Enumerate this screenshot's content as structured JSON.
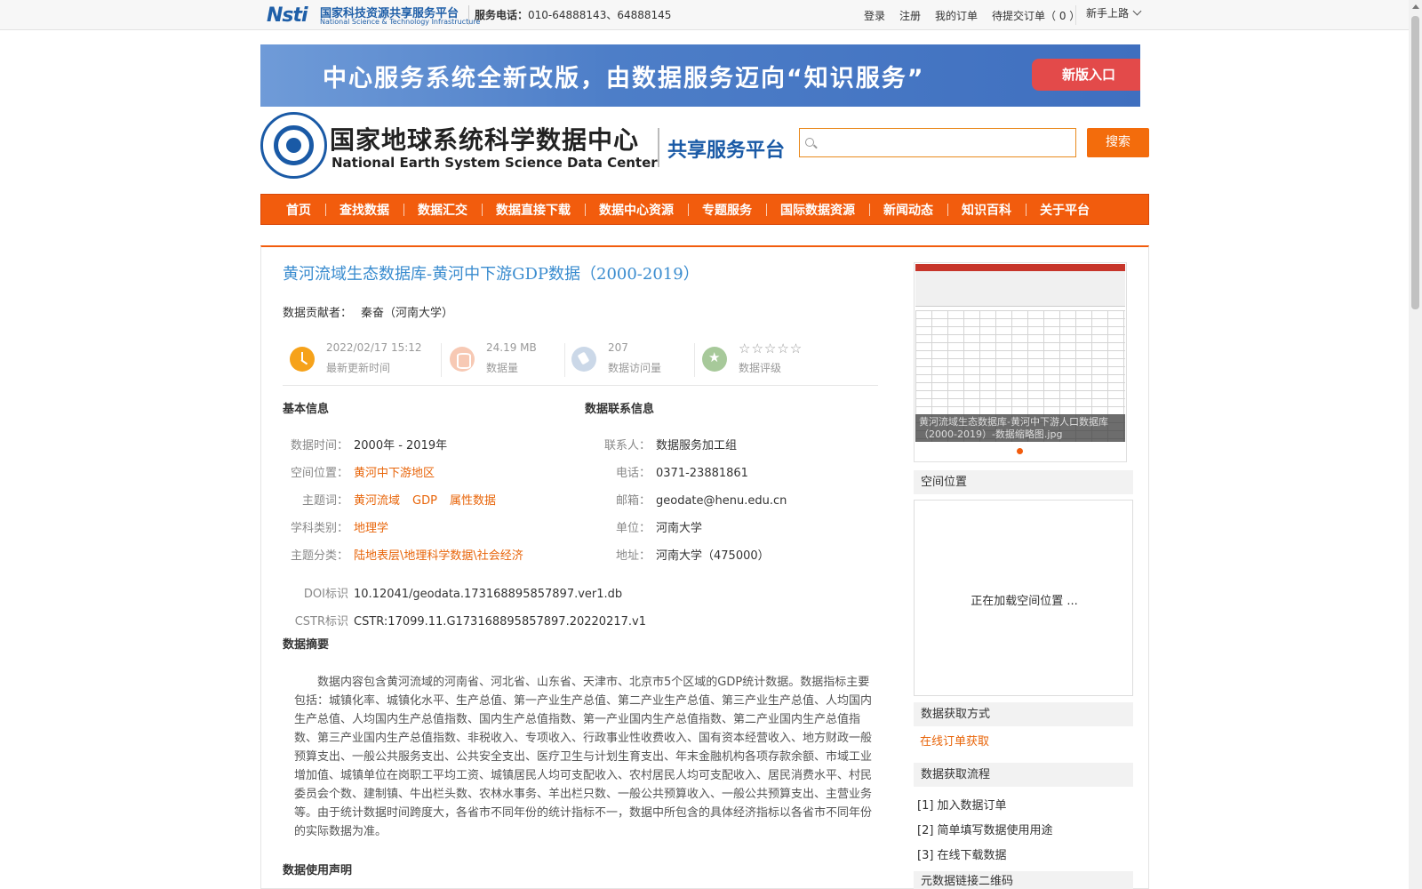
{
  "topbar": {
    "logo_mark": "Nsti",
    "logo_cn": "国家科技资源共享服务平台",
    "logo_en": "National Science & Technology Infrastructure",
    "phone_label": "服务电话：",
    "phone_value": "010-64888143、64888145",
    "links": [
      "登录",
      "注册",
      "我的订单",
      "待提交订单（ 0 ）"
    ],
    "newbie": "新手上路"
  },
  "banner": {
    "text": "中心服务系统全新改版，由数据服务迈向“知识服务”",
    "button": "新版入口"
  },
  "header": {
    "center_cn": "国家地球系统科学数据中心",
    "center_en": "National Earth System Science Data Center",
    "platform": "共享服务平台",
    "search_placeholder": "",
    "search_button": "搜索"
  },
  "nav": [
    "首页",
    "查找数据",
    "数据汇交",
    "数据直接下载",
    "数据中心资源",
    "专题服务",
    "国际数据资源",
    "新闻动态",
    "知识百科",
    "关于平台"
  ],
  "dataset": {
    "title": "黄河流域生态数据库-黄河中下游GDP数据（2000-2019）",
    "contributor_label": "数据贡献者：",
    "contributor": "秦奋（河南大学）",
    "stats": {
      "updated_value": "2022/02/17 15:12",
      "updated_label": "最新更新时间",
      "size_value": "24.19 MB",
      "size_label": "数据量",
      "visits_value": "207",
      "visits_label": "数据访问量",
      "rating_stars": "☆☆☆☆☆",
      "rating_label": "数据评级"
    },
    "basic_heading": "基本信息",
    "contact_heading": "数据联系信息",
    "basic": {
      "time_label": "数据时间：",
      "time_value": "2000年 - 2019年",
      "space_label": "空间位置：",
      "space_value": "黄河中下游地区",
      "keywords_label": "主题词：",
      "keywords": [
        "黄河流域",
        "GDP",
        "属性数据"
      ],
      "discipline_label": "学科类别：",
      "discipline_value": "地理学",
      "topic_label": "主题分类：",
      "topic_value": "陆地表层\\地理科学数据\\社会经济",
      "doi_label": "DOI标识",
      "doi_value": "10.12041/geodata.173168895857897.ver1.db",
      "cstr_label": "CSTR标识",
      "cstr_value": "CSTR:17099.11.G173168895857897.20220217.v1"
    },
    "contact": {
      "person_label": "联系人：",
      "person_value": "数据服务加工组",
      "phone_label": "电话：",
      "phone_value": "0371-23881861",
      "email_label": "邮箱：",
      "email_value": "geodate@henu.edu.cn",
      "org_label": "单位：",
      "org_value": "河南大学",
      "addr_label": "地址：",
      "addr_value": "河南大学（475000）"
    },
    "abstract_heading": "数据摘要",
    "abstract": "数据内容包含黄河流域的河南省、河北省、山东省、天津市、北京市5个区域的GDP统计数据。数据指标主要包括：城镇化率、城镇化水平、生产总值、第一产业生产总值、第二产业生产总值、第三产业生产总值、人均国内生产总值、人均国内生产总值指数、国内生产总值指数、第一产业国内生产总值指数、第二产业国内生产总值指数、第三产业国内生产总值指数、非税收入、专项收入、行政事业性收费收入、国有资本经营收入、地方财政一般预算支出、一般公共服务支出、公共安全支出、医疗卫生与计划生育支出、年末金融机构各项存款余额、市域工业增加值、城镇单位在岗职工平均工资、城镇居民人均可支配收入、农村居民人均可支配收入、居民消费水平、村民委员会个数、建制镇、牛出栏头数、农林水事务、羊出栏只数、一般公共预算收入、一般公共预算支出、主营业务等。由于统计数据时间跨度大，各省市不同年份的统计指标不一，数据中所包含的具体经济指标以各省市不同年份的实际数据为准。",
    "usage_heading": "数据使用声明"
  },
  "sidebar": {
    "thumb_caption": "黄河流域生态数据库-黄河中下游人口数据库（2000-2019）-数据缩略图.jpg",
    "spatial_heading": "空间位置",
    "spatial_loading": "正在加载空间位置 ...",
    "access_heading": "数据获取方式",
    "access_link": "在线订单获取",
    "flow_heading": "数据获取流程",
    "steps": [
      "[1] 加入数据订单",
      "[2] 简单填写数据使用用途",
      "[3] 在线下载数据"
    ],
    "qr_heading": "元数据链接二维码"
  },
  "colors": {
    "accent": "#f25c0d",
    "link": "#e8650a",
    "title": "#3a8ccf",
    "brand_blue": "#1a5aa6"
  }
}
